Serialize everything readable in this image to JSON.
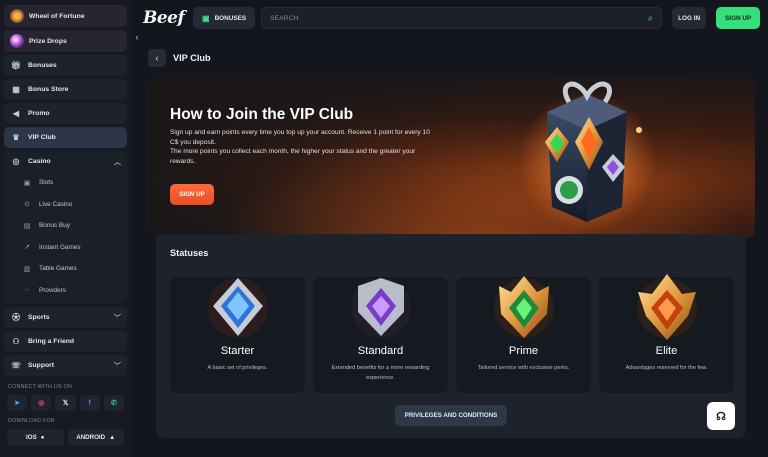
{
  "sidebar": {
    "featured": [
      {
        "label": "Wheel of Fortune"
      },
      {
        "label": "Prize Drops"
      }
    ],
    "items": [
      {
        "label": "Bonuses",
        "icon": "gift-icon"
      },
      {
        "label": "Bonus Store",
        "icon": "store-icon"
      },
      {
        "label": "Promo",
        "icon": "megaphone-icon"
      },
      {
        "label": "VIP Club",
        "icon": "crown-icon",
        "active": true
      }
    ],
    "casino": {
      "label": "Casino",
      "sub": [
        {
          "label": "Slots"
        },
        {
          "label": "Live Casino"
        },
        {
          "label": "Bonus Buy"
        },
        {
          "label": "Instant Games"
        },
        {
          "label": "Table Games"
        },
        {
          "label": "Providers"
        }
      ]
    },
    "sports": "Sports",
    "friend": "Bring a Friend",
    "support": "Support",
    "connect_caption": "CONNECT WITH US ON",
    "download_caption": "DOWNLOAD FOR",
    "ios": "IOS",
    "android": "ANDROID"
  },
  "header": {
    "logo": "Beef",
    "bonuses": "BONUSES",
    "search_placeholder": "SEARCH",
    "login": "LOG IN",
    "signup": "SIGN UP"
  },
  "page": {
    "title": "VIP Club"
  },
  "hero": {
    "title": "How to Join the VIP Club",
    "line1": "Sign up and earn points every time you top up your account. Receive 1 point for every 10 C$ you deposit.",
    "line2": "The more points you collect each month, the higher your status and the greater your rewards.",
    "cta": "SIGN UP"
  },
  "statuses": {
    "title": "Statuses",
    "cards": [
      {
        "name": "Starter",
        "desc": "A basic set of privileges."
      },
      {
        "name": "Standard",
        "desc": "Extended benefits for a more rewarding experience."
      },
      {
        "name": "Prime",
        "desc": "Tailored service with exclusive perks."
      },
      {
        "name": "Elite",
        "desc": "Advantages reserved for the few."
      }
    ],
    "button": "PRIVILEGES AND CONDITIONS"
  },
  "colors": {
    "accent_green": "#34e07b",
    "cta_orange": "#ff6a3d",
    "background": "#13161d"
  }
}
